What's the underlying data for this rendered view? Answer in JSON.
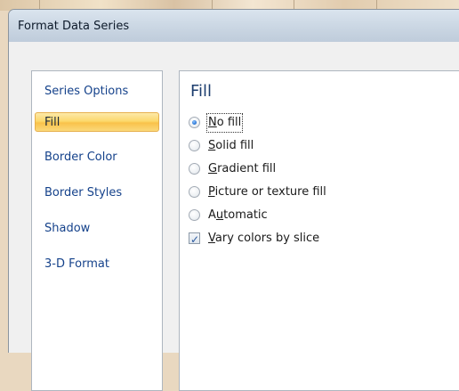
{
  "window": {
    "title": "Format Data Series"
  },
  "nav": {
    "items": [
      {
        "label": "Series Options",
        "selected": false
      },
      {
        "label": "Fill",
        "selected": true
      },
      {
        "label": "Border Color",
        "selected": false
      },
      {
        "label": "Border Styles",
        "selected": false
      },
      {
        "label": "Shadow",
        "selected": false
      },
      {
        "label": "3-D Format",
        "selected": false
      }
    ]
  },
  "fill": {
    "section_title": "Fill",
    "options": [
      {
        "pre": "",
        "mn": "N",
        "post": "o fill",
        "checked": true
      },
      {
        "pre": "",
        "mn": "S",
        "post": "olid fill",
        "checked": false
      },
      {
        "pre": "",
        "mn": "G",
        "post": "radient fill",
        "checked": false
      },
      {
        "pre": "",
        "mn": "P",
        "post": "icture or texture fill",
        "checked": false
      },
      {
        "pre": "A",
        "mn": "u",
        "post": "tomatic",
        "checked": false
      }
    ],
    "vary_colors": {
      "pre": "",
      "mn": "V",
      "post": "ary colors by slice",
      "checked": true
    }
  },
  "colors": {
    "selected_highlight": "#fcd86c",
    "nav_text": "#15428b",
    "section_title": "#1c3d6e"
  }
}
